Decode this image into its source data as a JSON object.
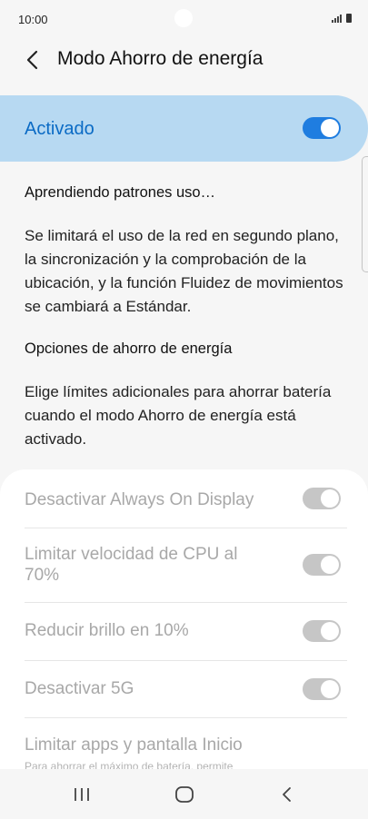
{
  "status_bar": {
    "time": "10:00"
  },
  "header": {
    "title": "Modo Ahorro de energía"
  },
  "master_switch": {
    "label": "Activado",
    "state": true,
    "accent": "#1f7de0",
    "card_color": "#b7d9f2"
  },
  "learning": {
    "title": "Aprendiendo patrones uso…",
    "description": "Se limitará el uso de la red en segundo plano, la sincronización y la comprobación de la ubicación, y la función Fluidez de movimientos se cambiará a Estándar."
  },
  "options_section": {
    "title": "Opciones de ahorro de energía",
    "description": "Elige límites adicionales para ahorrar batería cuando el modo Ahorro de energía está activado."
  },
  "options": [
    {
      "label": "Desactivar Always On Display",
      "enabled": false,
      "state": true
    },
    {
      "label": "Limitar velocidad de CPU al 70%",
      "enabled": false,
      "state": true
    },
    {
      "label": "Reducir brillo en 10%",
      "enabled": false,
      "state": true
    },
    {
      "label": "Desactivar 5G",
      "enabled": false,
      "state": true
    },
    {
      "label": "Limitar apps y pantalla Inicio",
      "subtitle": "Para ahorrar el máximo de batería, permite"
    }
  ],
  "nav": {
    "icons": [
      "recent-apps-icon",
      "home-icon",
      "back-icon"
    ]
  }
}
